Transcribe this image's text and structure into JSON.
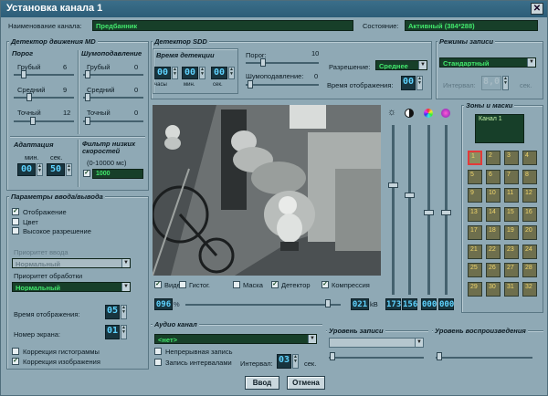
{
  "window": {
    "title": "Установка канала 1",
    "close": "✕"
  },
  "top": {
    "name_label": "Наименование канала:",
    "name_value": "Предбанник",
    "state_label": "Состояние:",
    "state_value": "Активный (384*288)"
  },
  "md": {
    "title": "Детектор движения MD",
    "threshold": "Порог",
    "noise": "Шумоподавление",
    "coarse": "Грубый",
    "coarse_val": "6",
    "medium": "Средний",
    "medium_val": "9",
    "fine": "Точный",
    "fine_val": "12",
    "n_coarse": "Грубый",
    "n_coarse_val": "0",
    "n_medium": "Средний",
    "n_medium_val": "0",
    "n_fine": "Точный",
    "n_fine_val": "0",
    "adapt": "Адаптация",
    "min": "мин.",
    "sec": "сек.",
    "adapt_min": "00",
    "adapt_sec": "50",
    "lpf": "Фильтр низких скоростей",
    "lpf_range": "(0-10000 мс)",
    "lpf_value": "1000"
  },
  "sdd": {
    "title": "Детектор SDD",
    "det_time": "Время детекции",
    "hours": "часы",
    "min": "мин.",
    "sec": "сек.",
    "h_val": "00",
    "m_val": "00",
    "s_val": "00",
    "threshold": "Порог:",
    "threshold_val": "10",
    "noise": "Шумоподавление:",
    "noise_val": "0",
    "resolution": "Разрешение:",
    "resolution_val": "Среднее",
    "display_time": "Время отображения:",
    "display_time_val": "00"
  },
  "rec": {
    "title": "Режимы записи",
    "mode": "Стандартный",
    "interval": "Интервал:",
    "interval_val": "8,0",
    "sec": "сек."
  },
  "io": {
    "title": "Параметры ввода/вывода",
    "display": "Отображение",
    "color": "Цвет",
    "hires": "Высокое разрешение",
    "input_prio": "Приоритет ввода",
    "input_prio_val": "Нормальный",
    "proc_prio": "Приоритет обработки",
    "proc_prio_val": "Нормальный",
    "disp_time": "Время отображения:",
    "disp_time_val": "05",
    "screen_no": "Номер экрана:",
    "screen_no_val": "01",
    "hist_corr": "Коррекция гистограммы",
    "img_corr": "Коррекция изображения"
  },
  "video": {
    "video": "Видео",
    "hist": "Гистог.",
    "mask": "Маска",
    "detector": "Детектор",
    "compression": "Компрессия",
    "quality": "096",
    "quality_unit": "%",
    "kb": "021",
    "kb_unit": "kB"
  },
  "adjust": {
    "v1": "173",
    "v2": "156",
    "v3": "000",
    "v4": "000"
  },
  "zones": {
    "title": "Зоны и маски",
    "channel": "Канал 1",
    "cells": [
      "1",
      "2",
      "3",
      "4",
      "5",
      "6",
      "7",
      "8",
      "9",
      "10",
      "11",
      "12",
      "13",
      "14",
      "15",
      "16",
      "17",
      "18",
      "19",
      "20",
      "21",
      "22",
      "23",
      "24",
      "25",
      "26",
      "27",
      "28",
      "29",
      "30",
      "31",
      "32"
    ]
  },
  "audio": {
    "title": "Аудио канал",
    "channel_val": "<нет>",
    "continuous": "Непрерывная запись",
    "interval_rec": "Запись интервалами",
    "interval": "Интервал:",
    "interval_val": "03",
    "sec": "сек."
  },
  "rec_level": {
    "title": "Уровень записи"
  },
  "play_level": {
    "title": "Уровень воспроизведения"
  },
  "buttons": {
    "ok": "Ввод",
    "cancel": "Отмена"
  },
  "colors": {
    "green_field": "#173f29",
    "green_text": "#42e86c",
    "lcd": "#5fd3ff",
    "panel": "#8fa9b5",
    "selected_zone": "#e23a3a"
  }
}
